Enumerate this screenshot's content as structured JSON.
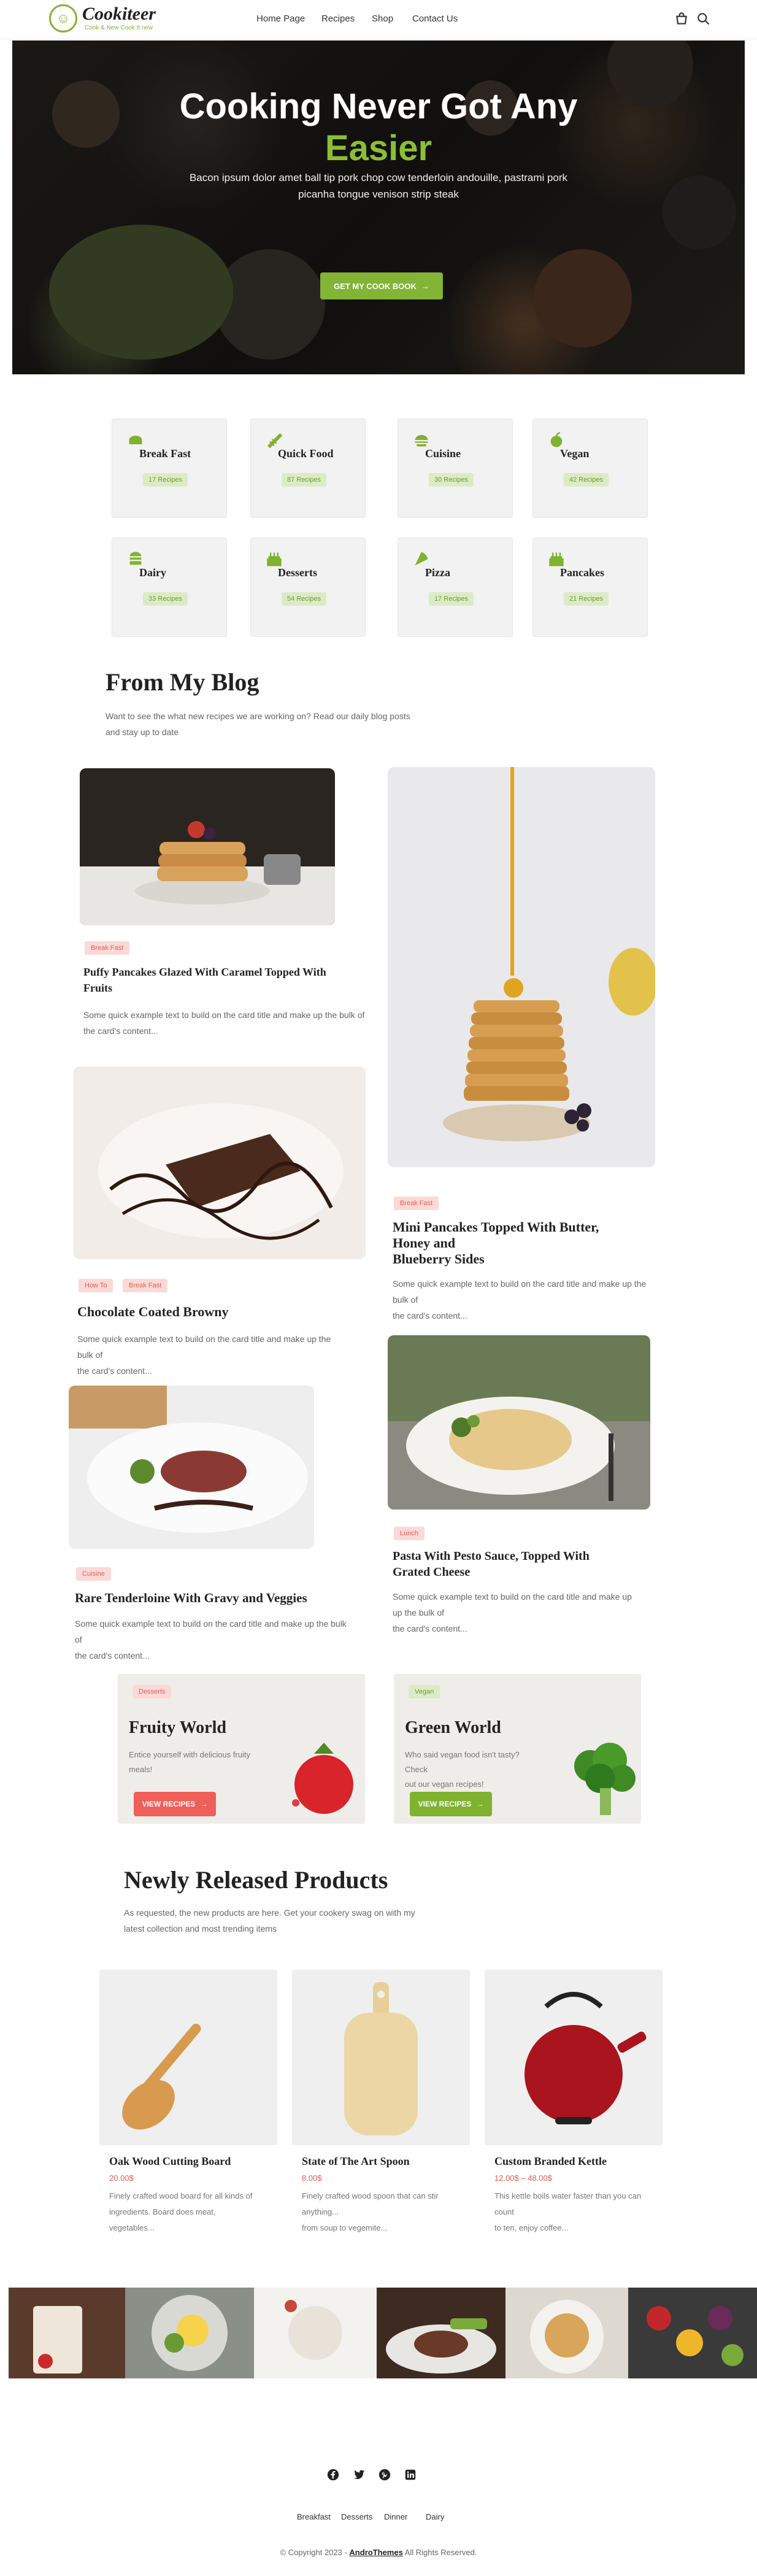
{
  "brand": {
    "name": "Cookiteer",
    "tagline": "Cook & New Cook It new"
  },
  "nav": [
    "Home Page",
    "Recipes",
    "Shop",
    "Contact Us"
  ],
  "hero": {
    "title_line1": "Cooking Never Got Any",
    "title_line2": "Easier",
    "text": "Bacon ipsum dolor amet ball tip pork chop cow tenderloin andouille, pastrami pork picanha tongue venison strip steak",
    "button": "GET MY COOK BOOK"
  },
  "categories": [
    {
      "name": "Break Fast",
      "count": "17 Recipes",
      "icon": "breakfast-icon"
    },
    {
      "name": "Quick Food",
      "count": "87 Recipes",
      "icon": "quick-food-icon"
    },
    {
      "name": "Cuisine",
      "count": "30 Recipes",
      "icon": "cuisine-icon"
    },
    {
      "name": "Vegan",
      "count": "42 Recipes",
      "icon": "vegan-icon"
    },
    {
      "name": "Dairy",
      "count": "33 Recipes",
      "icon": "dairy-icon"
    },
    {
      "name": "Desserts",
      "count": "54 Recipes",
      "icon": "desserts-icon"
    },
    {
      "name": "Pizza",
      "count": "17 Recipes",
      "icon": "pizza-icon"
    },
    {
      "name": "Pancakes",
      "count": "21 Recipes",
      "icon": "pancakes-icon"
    }
  ],
  "blog": {
    "title": "From My Blog",
    "subtitle_line1": "Want to see the what new recipes we are working on? Read our daily blog posts",
    "subtitle_line2": "and stay up to date",
    "posts": [
      {
        "tags": [
          "Break Fast"
        ],
        "title_line1": "Puffy Pancakes Glazed With Caramel Topped With",
        "title_line2": "Fruits",
        "desc_line1": "Some quick example text to build on the card title and make up the bulk of",
        "desc_line2": "the card's content..."
      },
      {
        "tags": [
          "Break Fast"
        ],
        "title_line1": "Mini Pancakes Topped With Butter,",
        "title_line2": "Honey and",
        "title_line3": "Blueberry Sides",
        "desc_line1": "Some quick example text to build on the card title and make up the",
        "desc_line2": "bulk of",
        "desc_line3": "the card's content..."
      },
      {
        "tags": [
          "How To",
          "Break Fast"
        ],
        "title_line1": "Chocolate Coated Browny",
        "desc_line1": "Some quick example text to build on the card title and make up the",
        "desc_line2": "bulk of",
        "desc_line3": "the card's content..."
      },
      {
        "tags": [
          "Lunch"
        ],
        "title_line1": "Pasta With Pesto Sauce, Topped With",
        "title_line2": "Grated Cheese",
        "desc_line1": "Some quick example text to build on the card title and make up",
        "desc_line2": "up the bulk of",
        "desc_line3": "the card's content..."
      },
      {
        "tags": [
          "Cuisine"
        ],
        "title_line1": "Rare Tenderloine With Gravy and Veggies",
        "desc_line1": "Some quick example text to build on the card title and make up the bulk",
        "desc_line2": "of",
        "desc_line3": "the card's content..."
      }
    ]
  },
  "promos": [
    {
      "tag": "Desserts",
      "title": "Fruity World",
      "text_line1": "Entice yourself with delicious fruity",
      "text_line2": "meals!",
      "button": "VIEW RECIPES",
      "color": "#ef5f5a"
    },
    {
      "tag": "Vegan",
      "title": "Green World",
      "text_line1": "Who said vegan food isn't tasty? Check",
      "text_line2": "out our vegan recipes!",
      "button": "VIEW RECIPES",
      "color": "#7fb22f"
    }
  ],
  "products": {
    "title": "Newly Released Products",
    "subtitle_line1": "As requested, the new products are here. Get your cookery swag on with my",
    "subtitle_line2": "latest collection and most trending items",
    "items": [
      {
        "name": "Oak Wood Cutting Board",
        "price": "20.00$",
        "desc_line1": "Finely crafted wood board for all kinds of",
        "desc_line2": "ingredients. Board does meat,",
        "desc_line3": "vegetables..."
      },
      {
        "name": "State of The Art Spoon",
        "price": "8.00$",
        "desc_line1": "Finely crafted wood spoon that can stir",
        "desc_line2": "anything...",
        "desc_line3": "from soup to vegemite..."
      },
      {
        "name": "Custom Branded Kettle",
        "price": "12.00$ – 48.00$",
        "desc_line1": "This kettle boils water faster than you can",
        "desc_line2": "count",
        "desc_line3": "to ten, enjoy coffee..."
      }
    ]
  },
  "footer": {
    "social": [
      "facebook-icon",
      "twitter-icon",
      "pinterest-icon",
      "linkedin-icon"
    ],
    "links": [
      "Breakfast",
      "Desserts",
      "Dinner",
      "Dairy"
    ],
    "copyright_prefix": "© Copyright 2023 - ",
    "copyright_brand": "AndroThemes",
    "copyright_suffix": " All Rights Reserved."
  },
  "colors": {
    "accent_green": "#82b435",
    "accent_red": "#ef5f5a",
    "text_dark": "#222222"
  }
}
